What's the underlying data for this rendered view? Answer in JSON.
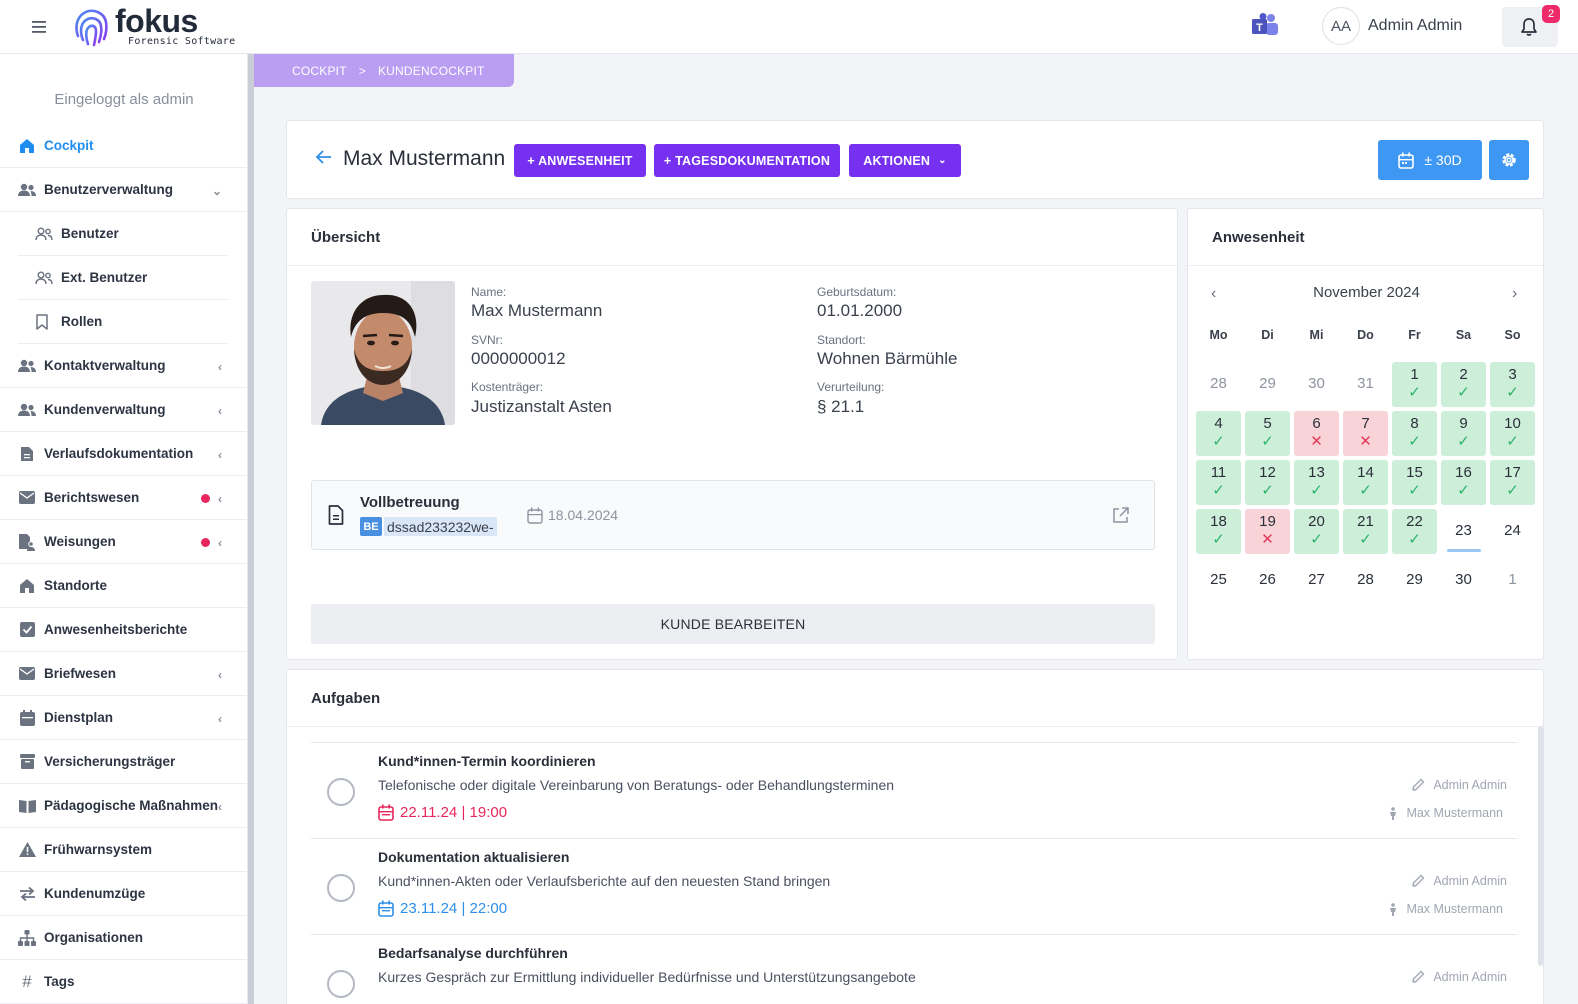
{
  "app": {
    "brand": "fokus",
    "brand_sub": "Forensic Software",
    "user_initials": "AA",
    "user_name": "Admin Admin",
    "notification_count": "2",
    "accent_color": "#7530f0",
    "primary_color": "#3e97f2"
  },
  "sidebar": {
    "logged_in": "Eingeloggt als admin",
    "items": [
      {
        "label": "Cockpit",
        "icon": "home-icon",
        "active": true
      },
      {
        "label": "Benutzerverwaltung",
        "icon": "users-icon",
        "expanded": true
      },
      {
        "label": "Benutzer",
        "icon": "user-outline-icon",
        "sub": true
      },
      {
        "label": "Ext. Benutzer",
        "icon": "user-outline-icon",
        "sub": true
      },
      {
        "label": "Rollen",
        "icon": "bookmark-icon",
        "sub": true
      },
      {
        "label": "Kontaktverwaltung",
        "icon": "users-icon"
      },
      {
        "label": "Kundenverwaltung",
        "icon": "users-icon"
      },
      {
        "label": "Verlaufsdokumentation",
        "icon": "document-icon"
      },
      {
        "label": "Berichtswesen",
        "icon": "mail-icon",
        "alert": true
      },
      {
        "label": "Weisungen",
        "icon": "file-user-icon",
        "alert": true
      },
      {
        "label": "Standorte",
        "icon": "home-icon"
      },
      {
        "label": "Anwesenheitsberichte",
        "icon": "checkbox-icon"
      },
      {
        "label": "Briefwesen",
        "icon": "mail-icon"
      },
      {
        "label": "Dienstplan",
        "icon": "calendar-icon"
      },
      {
        "label": "Versicherungsträger",
        "icon": "archive-icon"
      },
      {
        "label": "Pädagogische Maßnahmen",
        "icon": "book-icon"
      },
      {
        "label": "Frühwarnsystem",
        "icon": "warning-icon"
      },
      {
        "label": "Kundenumzüge",
        "icon": "swap-icon"
      },
      {
        "label": "Organisationen",
        "icon": "org-icon"
      },
      {
        "label": "Tags",
        "icon": "hash-icon"
      }
    ]
  },
  "breadcrumb": {
    "root": "COCKPIT",
    "separator": ">",
    "current": "KUNDENCOCKPIT"
  },
  "header": {
    "customer_name": "Max Mustermann",
    "btn_attendance": "+ ANWESENHEIT",
    "btn_daily_doc": "+ TAGESDOKUMENTATION",
    "btn_actions": "AKTIONEN",
    "btn_range": "± 30D"
  },
  "overview": {
    "title": "Übersicht",
    "fields": {
      "name_label": "Name:",
      "name": "Max Mustermann",
      "svnr_label": "SVNr:",
      "svnr": "0000000012",
      "payer_label": "Kostenträger:",
      "payer": "Justizanstalt Asten",
      "birth_label": "Geburtsdatum:",
      "birth": "01.01.2000",
      "location_label": "Standort:",
      "location": "Wohnen Bärmühle",
      "conviction_label": "Verurteilung:",
      "conviction": "§ 21.1"
    },
    "service": {
      "title": "Vollbetreuung",
      "tag": "BE",
      "code": "dssad233232we-",
      "date": "18.04.2024"
    },
    "edit_button": "KUNDE BEARBEITEN"
  },
  "attendance": {
    "title": "Anwesenheit",
    "month": "November 2024",
    "prev": "‹",
    "next": "›",
    "weekdays": [
      "Mo",
      "Di",
      "Mi",
      "Do",
      "Fr",
      "Sa",
      "So"
    ],
    "weeks": [
      [
        {
          "d": "28",
          "s": "muted"
        },
        {
          "d": "29",
          "s": "muted"
        },
        {
          "d": "30",
          "s": "muted"
        },
        {
          "d": "31",
          "s": "muted"
        },
        {
          "d": "1",
          "s": "ok"
        },
        {
          "d": "2",
          "s": "ok"
        },
        {
          "d": "3",
          "s": "ok"
        }
      ],
      [
        {
          "d": "4",
          "s": "ok"
        },
        {
          "d": "5",
          "s": "ok"
        },
        {
          "d": "6",
          "s": "no"
        },
        {
          "d": "7",
          "s": "no"
        },
        {
          "d": "8",
          "s": "ok"
        },
        {
          "d": "9",
          "s": "ok"
        },
        {
          "d": "10",
          "s": "ok"
        }
      ],
      [
        {
          "d": "11",
          "s": "ok"
        },
        {
          "d": "12",
          "s": "ok"
        },
        {
          "d": "13",
          "s": "ok"
        },
        {
          "d": "14",
          "s": "ok"
        },
        {
          "d": "15",
          "s": "ok"
        },
        {
          "d": "16",
          "s": "ok"
        },
        {
          "d": "17",
          "s": "ok"
        }
      ],
      [
        {
          "d": "18",
          "s": "ok"
        },
        {
          "d": "19",
          "s": "no"
        },
        {
          "d": "20",
          "s": "ok"
        },
        {
          "d": "21",
          "s": "ok"
        },
        {
          "d": "22",
          "s": "ok"
        },
        {
          "d": "23",
          "s": "today"
        },
        {
          "d": "24",
          "s": "plain"
        }
      ],
      [
        {
          "d": "25",
          "s": "plain"
        },
        {
          "d": "26",
          "s": "plain"
        },
        {
          "d": "27",
          "s": "plain"
        },
        {
          "d": "28",
          "s": "plain"
        },
        {
          "d": "29",
          "s": "plain"
        },
        {
          "d": "30",
          "s": "plain"
        },
        {
          "d": "1",
          "s": "muted"
        }
      ]
    ]
  },
  "tasks": {
    "title": "Aufgaben",
    "items": [
      {
        "title": "Kund*innen-Termin koordinieren",
        "description": "Telefonische oder digitale Vereinbarung von Beratungs- oder Behandlungsterminen",
        "due": "22.11.24 | 19:00",
        "due_color": "#e8265e",
        "author": "Admin Admin",
        "client": "Max Mustermann"
      },
      {
        "title": "Dokumentation aktualisieren",
        "description": "Kund*innen-Akten oder Verlaufsberichte auf den neuesten Stand bringen",
        "due": "23.11.24 | 22:00",
        "due_color": "#2f8fe8",
        "author": "Admin Admin",
        "client": "Max Mustermann"
      },
      {
        "title": "Bedarfsanalyse durchführen",
        "description": "Kurzes Gespräch zur Ermittlung individueller Bedürfnisse und Unterstützungsangebote",
        "author": "Admin Admin"
      }
    ]
  }
}
